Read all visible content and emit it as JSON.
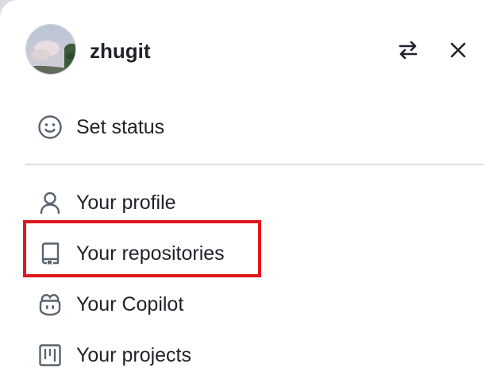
{
  "user": {
    "username": "zhugit"
  },
  "header_icons": {
    "switch_account": "switch-arrows-icon",
    "close": "close-icon"
  },
  "menu": {
    "set_status": "Set status",
    "profile": "Your profile",
    "repositories": "Your repositories",
    "copilot": "Your Copilot",
    "projects": "Your projects"
  },
  "colors": {
    "text": "#1f2328",
    "icon": "#59636e",
    "divider": "#d8dee4",
    "highlight": "#e0161c"
  }
}
